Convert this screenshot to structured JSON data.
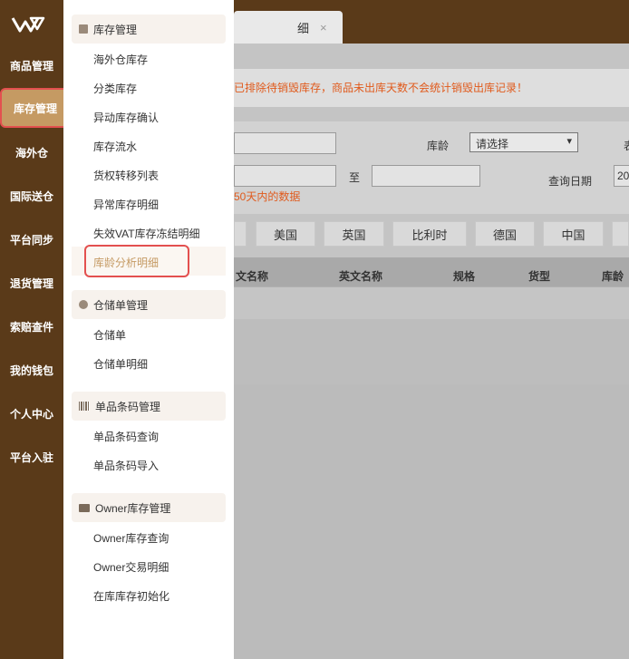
{
  "leftnav": {
    "items": [
      {
        "label": "商品管理"
      },
      {
        "label": "库存管理"
      },
      {
        "label": "海外仓"
      },
      {
        "label": "国际送仓"
      },
      {
        "label": "平台同步"
      },
      {
        "label": "退货管理"
      },
      {
        "label": "索赔查件"
      },
      {
        "label": "我的钱包"
      },
      {
        "label": "个人中心"
      },
      {
        "label": "平台入驻"
      }
    ]
  },
  "tab": {
    "label": "细",
    "close": "×"
  },
  "notice": "已排除待销毁库存，商品未出库天数不会统计销毁出库记录！",
  "filters": {
    "age_label": "库龄",
    "age_select": "请选择",
    "edge_char": "表",
    "to_label": "至",
    "date_label": "查询日期",
    "date_value": "20",
    "hint": "50天内的数据"
  },
  "country_tabs": [
    "美国",
    "英国",
    "比利时",
    "德国",
    "中国"
  ],
  "table": {
    "headers": [
      "文名称",
      "英文名称",
      "规格",
      "货型",
      "库龄"
    ]
  },
  "menu": {
    "groups": [
      {
        "title": "库存管理",
        "items": [
          "海外仓库存",
          "分类库存",
          "异动库存确认",
          "库存流水",
          "货权转移列表",
          "异常库存明细",
          "失效VAT库存冻结明细",
          "库龄分析明细"
        ]
      },
      {
        "title": "仓储单管理",
        "items": [
          "仓储单",
          "仓储单明细"
        ]
      },
      {
        "title": "单品条码管理",
        "items": [
          "单品条码查询",
          "单品条码导入"
        ]
      },
      {
        "title": "Owner库存管理",
        "items": [
          "Owner库存查询",
          "Owner交易明细",
          "在库库存初始化"
        ]
      }
    ]
  },
  "colors": {
    "nav_bg": "#5a3a19",
    "accent": "#c59a63",
    "highlight": "#e3504f",
    "warning_text": "#e05a1c"
  }
}
